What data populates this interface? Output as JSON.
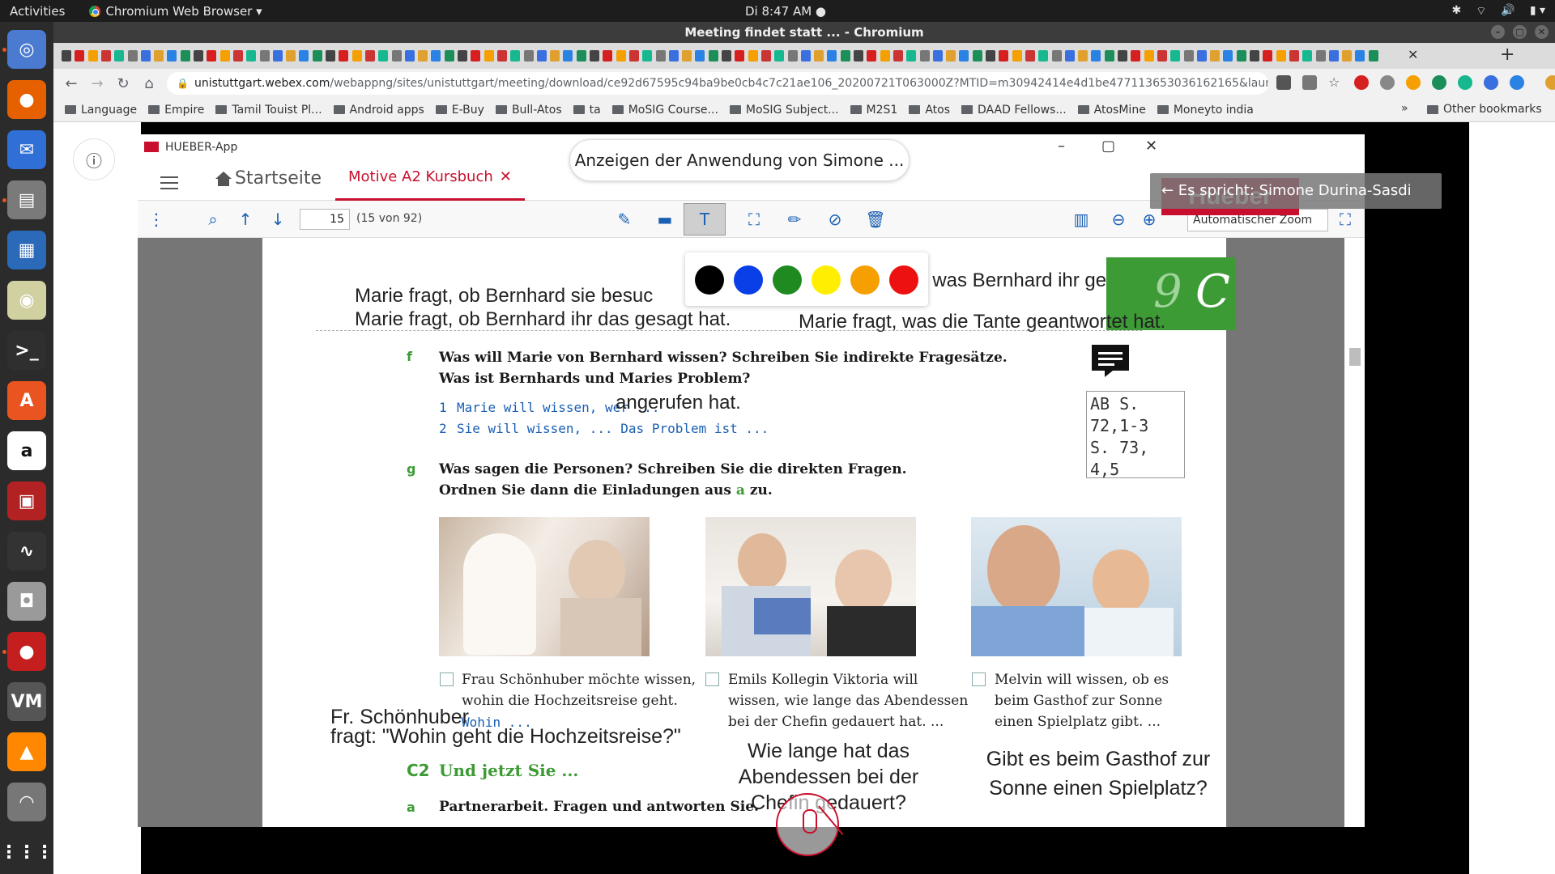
{
  "os": {
    "activities": "Activities",
    "app_menu": "Chromium Web Browser ▾",
    "clock": "Di  8:47 AM ●",
    "tray": [
      "✱",
      "⌔",
      "🔊",
      "▮ ▾"
    ]
  },
  "dock": {
    "apps": [
      {
        "name": "chromium",
        "glyph": "◎",
        "color": "#4a7bd1"
      },
      {
        "name": "firefox",
        "glyph": "●",
        "color": "#e66000"
      },
      {
        "name": "thunderbird",
        "glyph": "✉",
        "color": "#2f6fd6"
      },
      {
        "name": "files",
        "glyph": "▤",
        "color": "#7a7a7a"
      },
      {
        "name": "writer",
        "glyph": "▦",
        "color": "#2a6ab9"
      },
      {
        "name": "rhythmbox",
        "glyph": "◉",
        "color": "#d0d0a0"
      },
      {
        "name": "terminal",
        "glyph": ">_",
        "color": "#2f2f2f"
      },
      {
        "name": "software",
        "glyph": "A",
        "color": "#e95420"
      },
      {
        "name": "amazon",
        "glyph": "a",
        "color": "#ffffff"
      },
      {
        "name": "remote",
        "glyph": "▣",
        "color": "#b22222"
      },
      {
        "name": "monitor",
        "glyph": "∿",
        "color": "#333333"
      },
      {
        "name": "camera",
        "glyph": "◘",
        "color": "#9a9a9a"
      },
      {
        "name": "cherry",
        "glyph": "●",
        "color": "#c41e1e"
      },
      {
        "name": "vm",
        "glyph": "VM",
        "color": "#555555"
      },
      {
        "name": "vlc",
        "glyph": "▲",
        "color": "#ff8800"
      },
      {
        "name": "update",
        "glyph": "◠",
        "color": "#777777"
      },
      {
        "name": "show-apps",
        "glyph": "⋮⋮⋮",
        "color": "#2b2b2b"
      }
    ]
  },
  "browser": {
    "window_title": "Meeting findet statt ... - Chromium",
    "url_host": "unistuttgart.webex.com",
    "url_path": "/webappng/sites/unistuttgart/meeting/download/ce92d67595c94ba9be0cb4c7c21ae106_20200721T063000Z?MTID=m30942414e4d1be477113653036162165&launchApp...",
    "bookmarks": [
      "Language",
      "Empire",
      "Tamil Touist Pl...",
      "Android apps",
      "E-Buy",
      "Bull-Atos",
      "ta",
      "MoSIG Course...",
      "MoSIG Subject...",
      "M2S1",
      "Atos",
      "DAAD Fellows...",
      "AtosMine",
      "Moneyto india"
    ],
    "bookmarks_more": "»",
    "other_bookmarks": "Other bookmarks"
  },
  "hueber": {
    "app_name": "HUEBER-App",
    "share_notice": "Anzeigen der Anwendung von Simone ...",
    "home_label": "Startseite",
    "book_tab": "Motive A2 Kursbuch",
    "logo_text": "Hueber",
    "speaking": "← Es spricht: Simone Durina-Sasdi",
    "page_num": "15",
    "page_count": "(15 von 92)",
    "zoom": "Automatischer Zoom"
  },
  "doc": {
    "ann_top1": "Marie fragt, ob Bernhard sie besuc",
    "ann_top2": "Marie fragt, ob Bernhard ihr das gesagt hat.",
    "ann_top3": ", was Bernhard ihr gesagt hat.",
    "ann_top4": "Marie fragt, was die Tante geantwortet hat.",
    "tab_number": "9",
    "tab_letter": "C",
    "f_letter": "f",
    "f_line1": "Was will Marie von Bernhard wissen? Schreiben Sie indirekte Fragesätze.",
    "f_line2": "Was ist Bernhards und Maries Problem?",
    "f_item1_num": "1",
    "f_item1": "Marie will wissen, wer ...",
    "f_item1_ann": "angerufen hat.",
    "f_item2_num": "2",
    "f_item2": "Sie will wissen, ... Das Problem ist ...",
    "note": "AB S.\n72,1-3\nS. 73,\n4,5",
    "g_letter": "g",
    "g_line1": "Was sagen die Personen? Schreiben Sie die direkten Fragen.",
    "g_line2_a": "Ordnen Sie dann die Einladungen aus ",
    "g_line2_b": "a",
    "g_line2_c": " zu.",
    "cap1": [
      "Frau Schönhuber möchte wissen,",
      "wohin die Hochzeitsreise geht."
    ],
    "cap1_hand": "Wohin ...",
    "cap2": [
      "Emils Kollegin Viktoria will",
      "wissen, wie lange das Abendessen",
      "bei der Chefin gedauert hat. ..."
    ],
    "cap3": [
      "Melvin will wissen, ob es",
      "beim Gasthof zur Sonne",
      "einen Spielplatz gibt. ..."
    ],
    "ann1_a": "Fr. Schönhuber",
    "ann1_b": "fragt: \"Wohin geht die Hochzeitsreise?\"",
    "ann2": [
      "Wie lange hat das",
      "Abendessen bei der",
      "Chefin gedauert?"
    ],
    "ann3": [
      "Gibt es beim Gasthof zur",
      "Sonne einen Spielplatz?"
    ],
    "c2_label": "C2",
    "c2_title": "Und jetzt Sie ...",
    "a_letter": "a",
    "a_text": "Partnerarbeit. Fragen und antworten Sie."
  },
  "colors": {
    "palette": [
      "#000000",
      "#0a3ee6",
      "#1f8a1f",
      "#ffee00",
      "#f5a000",
      "#ee1111"
    ],
    "accent": "#c8102e",
    "book_green": "#3d9b35"
  }
}
